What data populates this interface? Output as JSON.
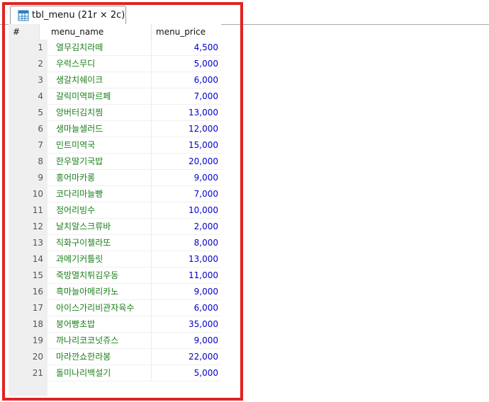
{
  "tab": {
    "label": "tbl_menu (21r × 2c)",
    "icon": "table-icon"
  },
  "columns": {
    "num": "#",
    "name": "menu_name",
    "price": "menu_price"
  },
  "rows": [
    {
      "n": "1",
      "name": "열무김치라떼",
      "price": "4,500"
    },
    {
      "n": "2",
      "name": "우럭스무디",
      "price": "5,000"
    },
    {
      "n": "3",
      "name": "생갈치쉐이크",
      "price": "6,000"
    },
    {
      "n": "4",
      "name": "갈릭미역파르페",
      "price": "7,000"
    },
    {
      "n": "5",
      "name": "앙버터김치찜",
      "price": "13,000"
    },
    {
      "n": "6",
      "name": "생마늘샐러드",
      "price": "12,000"
    },
    {
      "n": "7",
      "name": "민트미역국",
      "price": "15,000"
    },
    {
      "n": "8",
      "name": "한우딸기국밥",
      "price": "20,000"
    },
    {
      "n": "9",
      "name": "홍어마카롱",
      "price": "9,000"
    },
    {
      "n": "10",
      "name": "코다리마늘빵",
      "price": "7,000"
    },
    {
      "n": "11",
      "name": "정어리빙수",
      "price": "10,000"
    },
    {
      "n": "12",
      "name": "날치알스크류바",
      "price": "2,000"
    },
    {
      "n": "13",
      "name": "직화구이젤라또",
      "price": "8,000"
    },
    {
      "n": "14",
      "name": "과메기커틀릿",
      "price": "13,000"
    },
    {
      "n": "15",
      "name": "죽방멸치튀김우동",
      "price": "11,000"
    },
    {
      "n": "16",
      "name": "흑마늘아메리카노",
      "price": "9,000"
    },
    {
      "n": "17",
      "name": "아이스가리비관자육수",
      "price": "6,000"
    },
    {
      "n": "18",
      "name": "붕어빵초밥",
      "price": "35,000"
    },
    {
      "n": "19",
      "name": "까나리코코넛쥬스",
      "price": "9,000"
    },
    {
      "n": "20",
      "name": "마라깐쇼한라봉",
      "price": "22,000"
    },
    {
      "n": "21",
      "name": "돌미나리백설기",
      "price": "5,000"
    }
  ],
  "colors": {
    "highlight": "#e32222",
    "name_text": "#1a7f1a",
    "price_text": "#0000cc"
  }
}
